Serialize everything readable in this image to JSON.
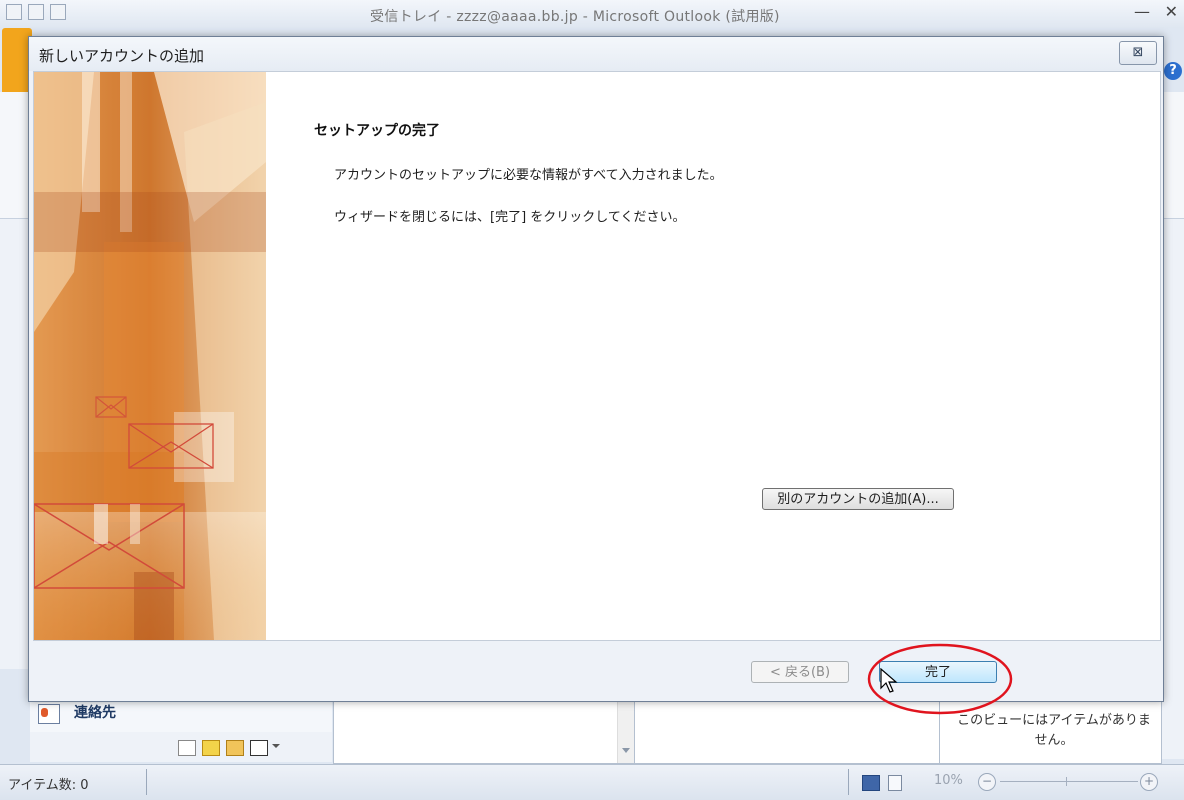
{
  "background_window": {
    "title": "受信トレイ - zzzz@aaaa.bb.jp - Microsoft Outlook (試用版)",
    "nav_contacts_label": "連絡先",
    "todo_empty_text": "このビューにはアイテムがありません。",
    "status_items": "アイテム数: 0",
    "zoom_level": "10%",
    "help_glyph": "?"
  },
  "dialog": {
    "title": "新しいアカウントの追加",
    "close_glyph": "⊠",
    "heading": "セットアップの完了",
    "body_line1": "アカウントのセットアップに必要な情報がすべて入力されました。",
    "body_line2": "ウィザードを閉じるには、[完了] をクリックしてください。",
    "add_account_button": "別のアカウントの追加(A)...",
    "back_button": "< 戻る(B)",
    "finish_button": "完了"
  },
  "colors": {
    "annotation_circle": "#e0141e",
    "graphic_orange": "#d98a3a",
    "file_tab": "#f2a51c"
  },
  "icons": [
    "outlook-icon",
    "save-icon",
    "undo-icon",
    "help-icon",
    "close-icon",
    "contacts-icon",
    "notes-icon",
    "folder-icon",
    "shortcut-icon",
    "mouse-cursor-icon",
    "envelope-icon"
  ]
}
